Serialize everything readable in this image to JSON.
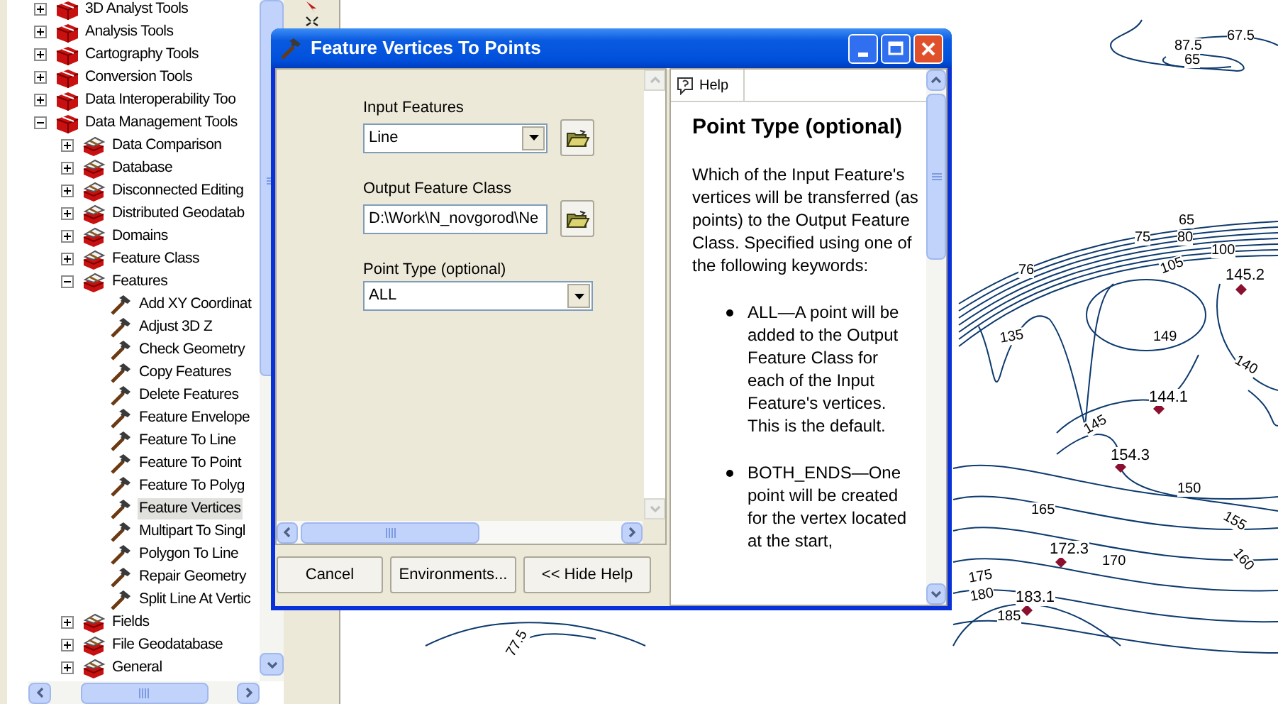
{
  "tree": [
    {
      "label": "3D Analyst Tools",
      "expanded": false,
      "selected": false
    },
    {
      "label": "Analysis Tools",
      "expanded": false,
      "selected": false
    },
    {
      "label": "Cartography Tools",
      "expanded": false,
      "selected": false
    },
    {
      "label": "Conversion Tools",
      "expanded": false,
      "selected": false
    },
    {
      "label": "Data Interoperability Too",
      "expanded": false,
      "selected": false
    },
    {
      "label": "Data Management Tools",
      "expanded": true,
      "selected": false,
      "children": [
        {
          "label": "Data Comparison",
          "expanded": false,
          "selected": false
        },
        {
          "label": "Database",
          "expanded": false,
          "selected": false
        },
        {
          "label": "Disconnected Editing",
          "expanded": false,
          "selected": false
        },
        {
          "label": "Distributed Geodatab",
          "expanded": false,
          "selected": false
        },
        {
          "label": "Domains",
          "expanded": false,
          "selected": false
        },
        {
          "label": "Feature Class",
          "expanded": false,
          "selected": false
        },
        {
          "label": "Features",
          "expanded": true,
          "selected": false,
          "children": [
            {
              "label": "Add XY Coordinat",
              "selected": false
            },
            {
              "label": "Adjust 3D Z",
              "selected": false
            },
            {
              "label": "Check Geometry",
              "selected": false
            },
            {
              "label": "Copy Features",
              "selected": false
            },
            {
              "label": "Delete Features",
              "selected": false
            },
            {
              "label": "Feature Envelope",
              "selected": false
            },
            {
              "label": "Feature To Line",
              "selected": false
            },
            {
              "label": "Feature To Point",
              "selected": false
            },
            {
              "label": "Feature To Polyg",
              "selected": false
            },
            {
              "label": "Feature Vertices",
              "selected": true
            },
            {
              "label": "Multipart To Singl",
              "selected": false
            },
            {
              "label": "Polygon To Line",
              "selected": false
            },
            {
              "label": "Repair Geometry",
              "selected": false
            },
            {
              "label": "Split Line At Vertic",
              "selected": false
            }
          ]
        },
        {
          "label": "Fields",
          "expanded": false,
          "selected": false
        },
        {
          "label": "File Geodatabase",
          "expanded": false,
          "selected": false
        },
        {
          "label": "General",
          "expanded": false,
          "selected": false
        }
      ]
    }
  ],
  "dialog": {
    "title": "Feature Vertices To Points",
    "parameters": [
      {
        "kind": "dropdown",
        "label": "Input Features",
        "value": "Line",
        "browse": true
      },
      {
        "kind": "text",
        "label": "Output Feature Class",
        "value": "D:\\Work\\N_novgorod\\Ne",
        "browse": true
      },
      {
        "kind": "dropdown",
        "label": "Point Type (optional)",
        "value": "ALL",
        "browse": false
      }
    ],
    "buttons": [
      "Cancel",
      "Environments...",
      "<< Hide Help"
    ],
    "help": {
      "tab": "Help",
      "title": "Point Type (optional)",
      "paragraph": "Which of the Input Feature's vertices will be transferred (as points) to the Output Feature Class. Specified using one of the following keywords:",
      "bullets": [
        "ALL—A point will be added to the Output Feature Class for each of the Input Feature's vertices. This is the default.",
        "BOTH_ENDS—One point will be created for the vertex located at the start,"
      ]
    }
  },
  "map": {
    "contour_labels": [
      "67.5",
      "87.5",
      "65",
      "65",
      "75",
      "80",
      "100",
      "105",
      "76",
      "135",
      "149",
      "140",
      "145",
      "150",
      "165",
      "155",
      "170",
      "160",
      "175",
      "180",
      "185",
      "77.5"
    ],
    "elevation_points": [
      "145.2",
      "144.1",
      "154.3",
      "172.3",
      "183.1"
    ]
  }
}
